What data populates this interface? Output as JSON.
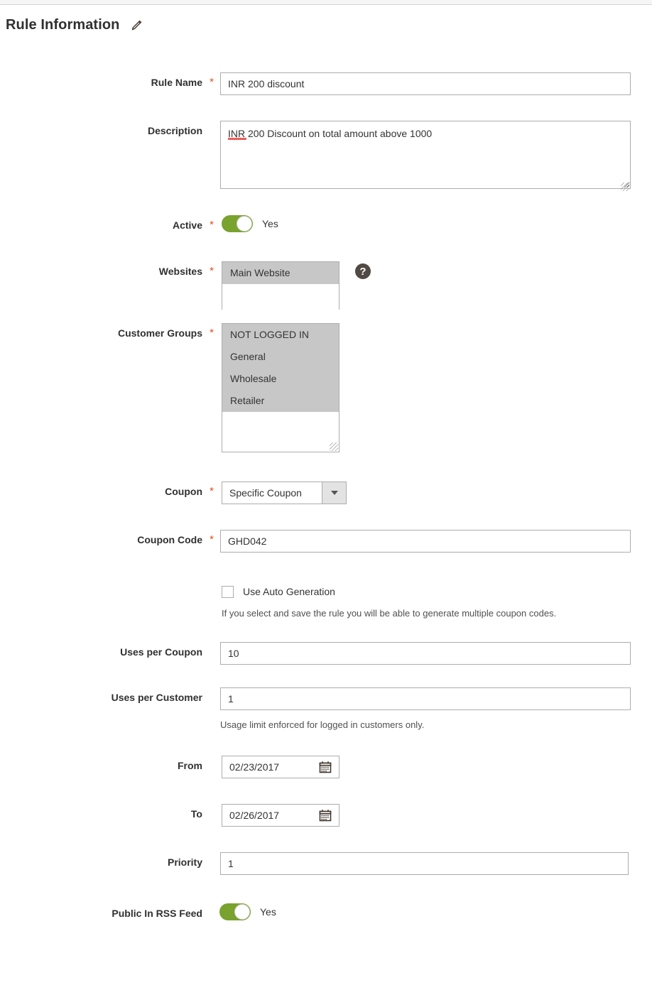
{
  "section": {
    "title": "Rule Information",
    "edit_icon": "pencil-icon"
  },
  "form": {
    "rule_name": {
      "label": "Rule Name",
      "required": "*",
      "value": "INR 200 discount"
    },
    "description": {
      "label": "Description",
      "required": "",
      "value": "INR 200 Discount on total amount above 1000"
    },
    "active": {
      "label": "Active",
      "required": "*",
      "state": "Yes"
    },
    "websites": {
      "label": "Websites",
      "required": "*",
      "options": [
        {
          "label": "Main Website",
          "selected": true
        }
      ],
      "help_icon": "help-icon",
      "help_glyph": "?"
    },
    "customer_groups": {
      "label": "Customer Groups",
      "required": "*",
      "options": [
        {
          "label": "NOT LOGGED IN",
          "selected": true
        },
        {
          "label": "General",
          "selected": true
        },
        {
          "label": "Wholesale",
          "selected": true
        },
        {
          "label": "Retailer",
          "selected": true
        }
      ]
    },
    "coupon": {
      "label": "Coupon",
      "required": "*",
      "value": "Specific Coupon",
      "arrow_icon": "chevron-down-icon"
    },
    "coupon_code": {
      "label": "Coupon Code",
      "required": "*",
      "value": "GHD042"
    },
    "auto_generation": {
      "label": "Use Auto Generation",
      "checked": false,
      "note": "If you select and save the rule you will be able to generate multiple coupon codes."
    },
    "uses_per_coupon": {
      "label": "Uses per Coupon",
      "required": "",
      "value": "10"
    },
    "uses_per_customer": {
      "label": "Uses per Customer",
      "required": "",
      "value": "1",
      "note": "Usage limit enforced for logged in customers only."
    },
    "from": {
      "label": "From",
      "required": "",
      "value": "02/23/2017",
      "calendar_icon": "calendar-icon"
    },
    "to": {
      "label": "To",
      "required": "",
      "value": "02/26/2017",
      "calendar_icon": "calendar-icon"
    },
    "priority": {
      "label": "Priority",
      "required": "",
      "value": "1"
    },
    "public_rss": {
      "label": "Public In RSS Feed",
      "required": "",
      "state": "Yes"
    }
  },
  "colors": {
    "accent_green": "#79a22e",
    "required_orange": "#e04f1a",
    "selected_grey": "#c7c7c7",
    "border_grey": "#adadad",
    "help_dark": "#514943"
  }
}
